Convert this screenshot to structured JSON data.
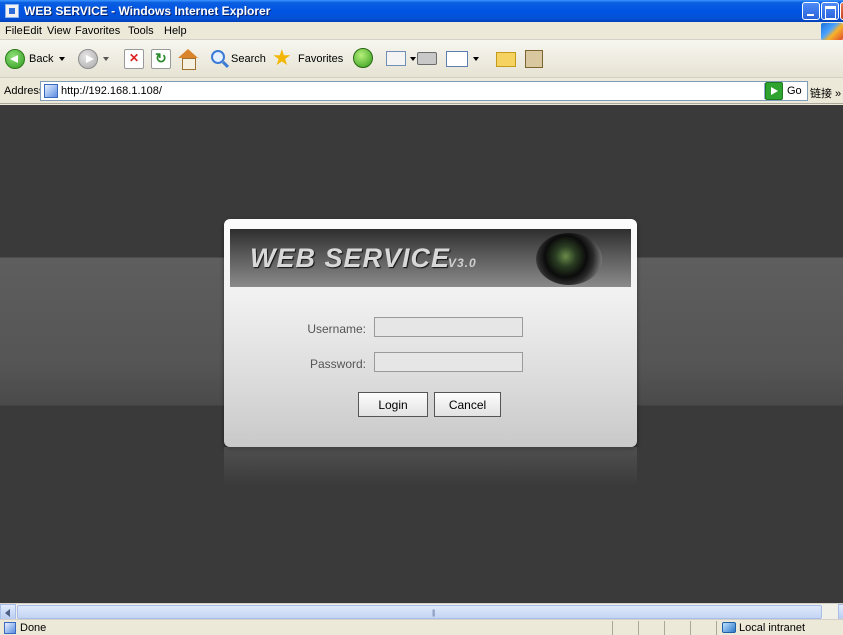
{
  "window": {
    "title": "WEB SERVICE - Windows Internet Explorer"
  },
  "menu": {
    "items": [
      "File",
      "Edit",
      "View",
      "Favorites",
      "Tools",
      "Help"
    ]
  },
  "toolbar": {
    "back_label": "Back",
    "search_label": "Search",
    "favorites_label": "Favorites",
    "icons": [
      "back-icon",
      "forward-icon",
      "stop-icon",
      "refresh-icon",
      "home-icon",
      "search-icon",
      "favorites-star-icon",
      "media-icon",
      "mail-icon",
      "print-icon",
      "edit-icon",
      "folder-icon",
      "research-icon"
    ]
  },
  "address": {
    "label": "Address",
    "url": "http://192.168.1.108/",
    "go_label": "Go",
    "links_label": "链接 »"
  },
  "login": {
    "brand": "WEB  SERVICE",
    "version": "V3.0",
    "username_label": "Username:",
    "password_label": "Password:",
    "username_value": "",
    "password_value": "",
    "login_button": "Login",
    "cancel_button": "Cancel"
  },
  "scrollbar": {
    "grip": "|||"
  },
  "status": {
    "text": "Done",
    "zone": "Local intranet"
  },
  "colors": {
    "titlebar": "#0054e3",
    "page_background": "#3a3a3a",
    "panel_background": "#f0f0f0"
  }
}
